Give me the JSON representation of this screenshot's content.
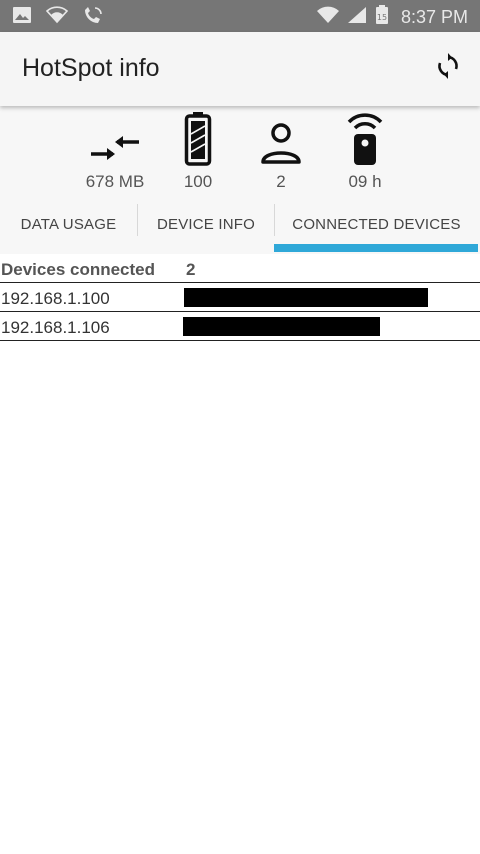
{
  "status_bar": {
    "time": "8:37 PM",
    "icons": [
      "image-icon",
      "wifi-hotspot-icon",
      "phone-icon",
      "wifi-signal-icon",
      "cell-signal-icon",
      "battery-icon"
    ]
  },
  "app_bar": {
    "title": "HotSpot info",
    "refresh_icon": "refresh-icon"
  },
  "stats": [
    {
      "icon": "data-transfer-icon",
      "value": "678 MB"
    },
    {
      "icon": "battery-full-icon",
      "value": "100"
    },
    {
      "icon": "person-icon",
      "value": "2"
    },
    {
      "icon": "hotspot-device-icon",
      "value": "09 h"
    }
  ],
  "tabs": [
    {
      "label": "DATA USAGE",
      "selected": false
    },
    {
      "label": "DEVICE INFO",
      "selected": false
    },
    {
      "label": "CONNECTED DEVICES",
      "selected": true
    }
  ],
  "accent_color": "#2fa8d8",
  "devices_table": {
    "header_label": "Devices connected",
    "header_value": "2",
    "rows": [
      {
        "ip": "192.168.1.100"
      },
      {
        "ip": "192.168.1.106"
      }
    ]
  }
}
